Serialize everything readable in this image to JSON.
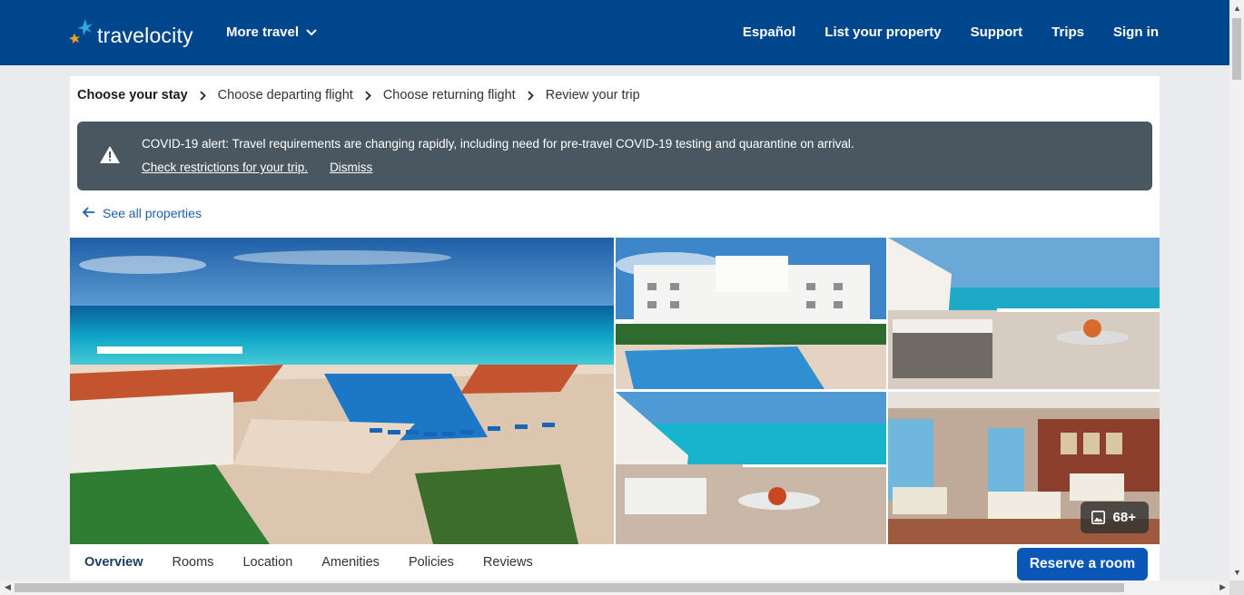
{
  "header": {
    "logo_text": "travelocity",
    "more_travel": "More travel",
    "nav": [
      "Español",
      "List your property",
      "Support",
      "Trips",
      "Sign in"
    ]
  },
  "breadcrumb": {
    "steps": [
      "Choose your stay",
      "Choose departing flight",
      "Choose returning flight",
      "Review your trip"
    ]
  },
  "alert": {
    "message": "COVID-19 alert: Travel requirements are changing rapidly, including need for pre-travel COVID-19 testing and quarantine on arrival.",
    "check_link": "Check restrictions for your trip.",
    "dismiss_link": "Dismiss"
  },
  "back_link": "See all properties",
  "gallery": {
    "photo_count": "68+"
  },
  "tabs": [
    "Overview",
    "Rooms",
    "Location",
    "Amenities",
    "Policies",
    "Reviews"
  ],
  "reserve_button": "Reserve a room",
  "colors": {
    "header_bg": "#00468c",
    "alert_bg": "#4b5760",
    "link": "#1d5fae",
    "reserve_bg": "#0a57b7"
  }
}
